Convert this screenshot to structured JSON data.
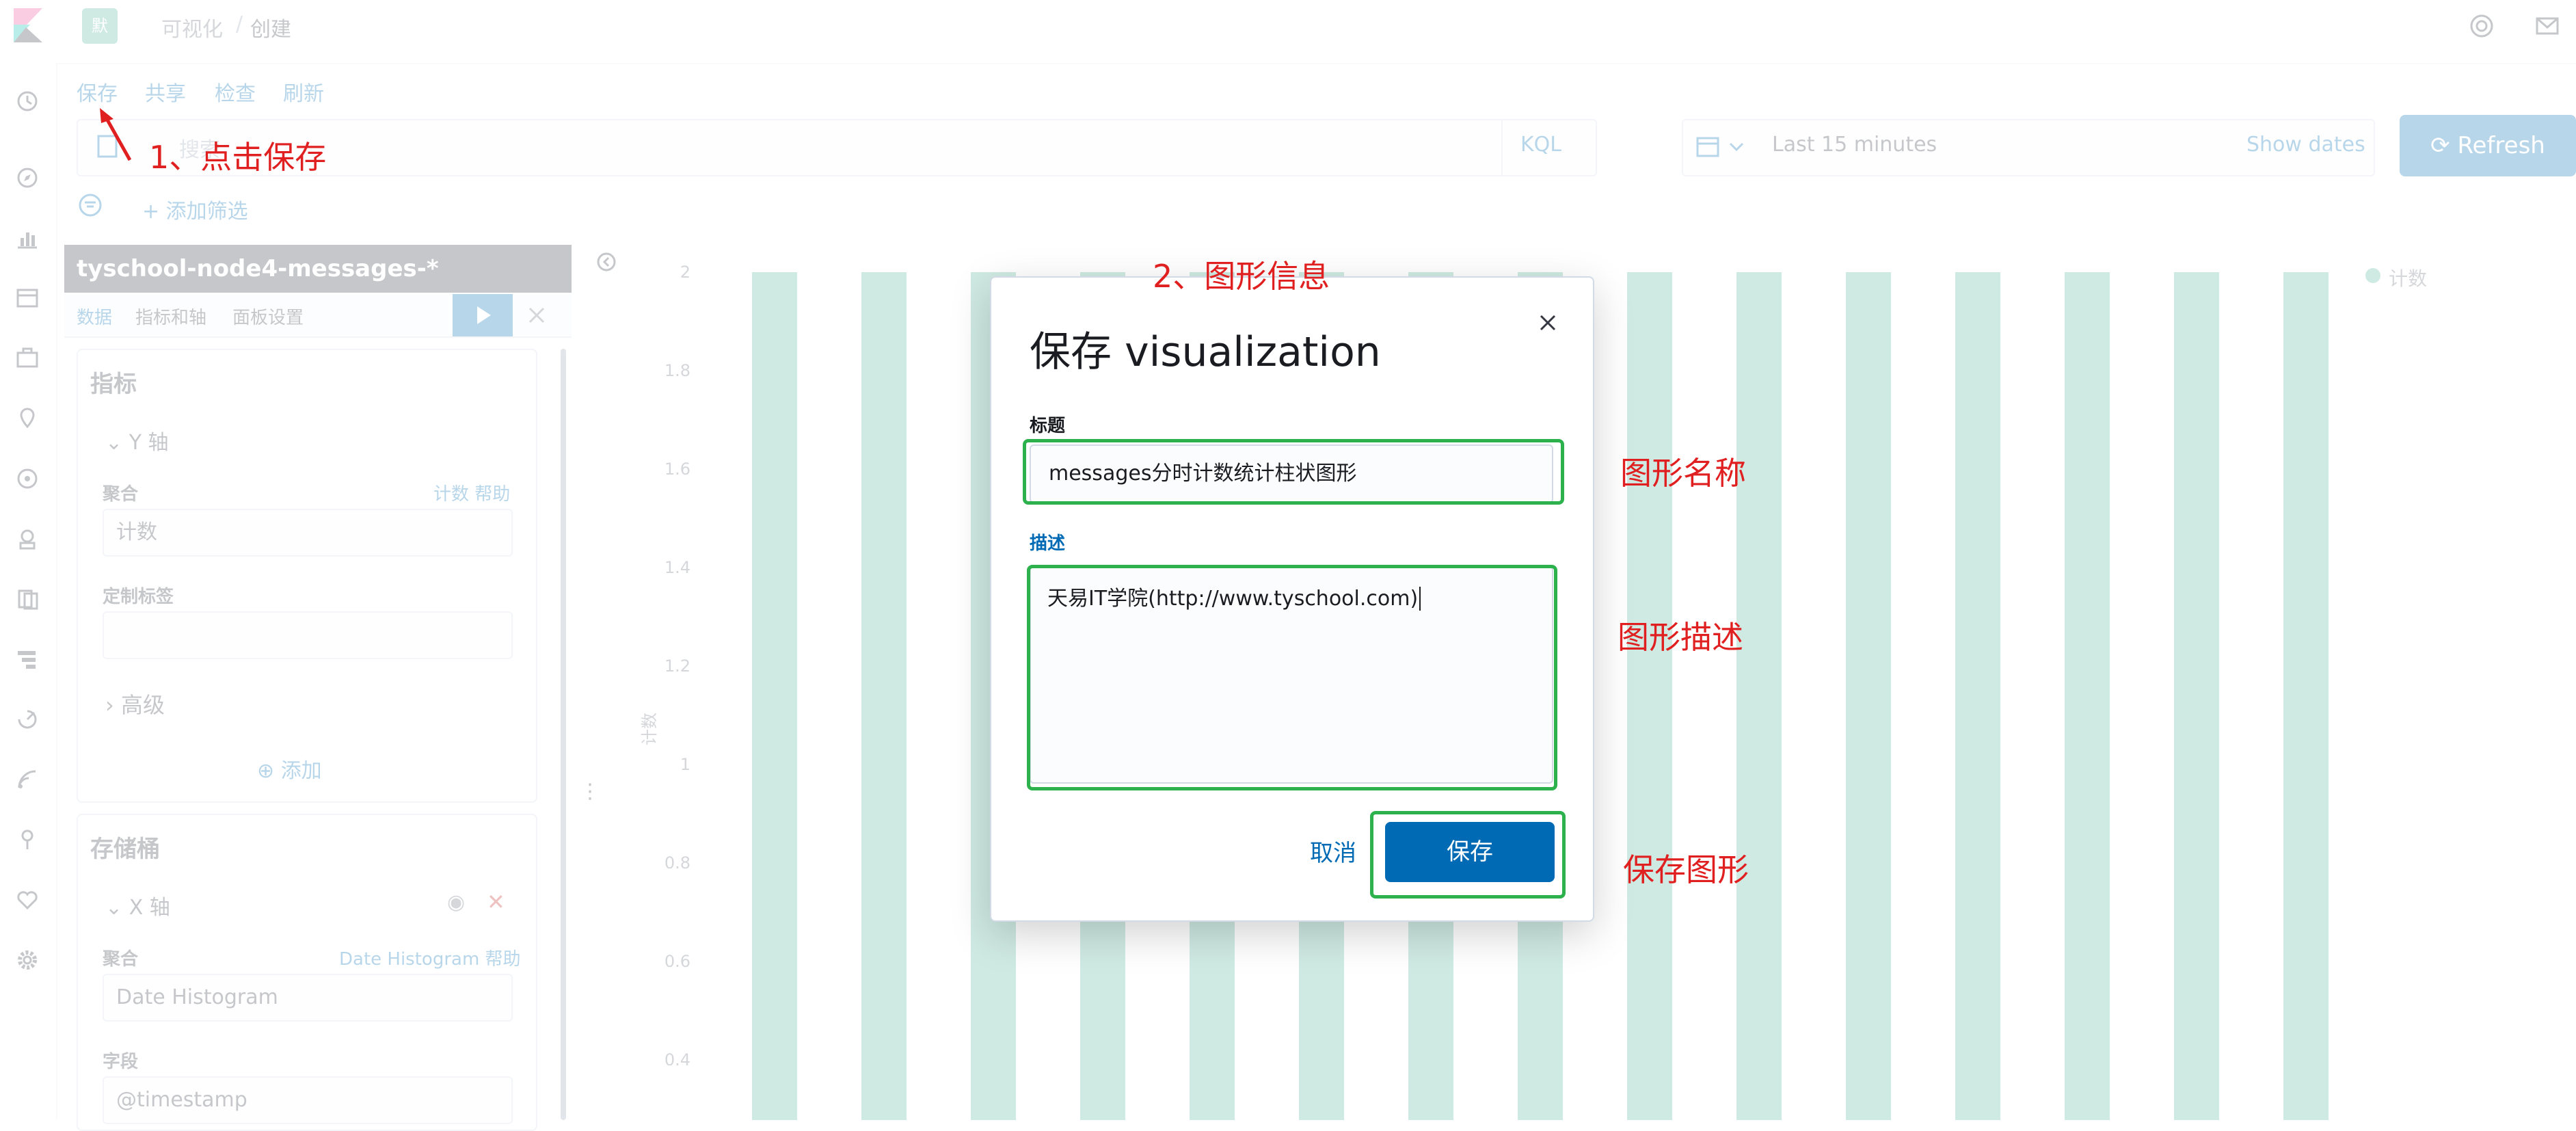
{
  "header": {
    "space_letter": "默",
    "breadcrumb": [
      "可视化",
      "创建"
    ]
  },
  "toolbar": {
    "links": [
      "保存",
      "共享",
      "检查",
      "刷新"
    ],
    "search_placeholder": "搜索",
    "kql": "KQL",
    "time_range": "Last 15 minutes",
    "show_dates": "Show dates",
    "refresh": "Refresh",
    "add_filter": "+ 添加筛选"
  },
  "editor": {
    "index_pattern": "tyschool-node4-messages-*",
    "tabs": [
      "数据",
      "指标和轴",
      "面板设置"
    ],
    "metrics_title": "指标",
    "y_axis": "Y 轴",
    "aggregation_label": "聚合",
    "metric_help": "计数 帮助",
    "metric_value": "计数",
    "custom_label": "定制标签",
    "advanced": "高级",
    "add_button": "添加",
    "buckets_title": "存储桶",
    "x_axis": "X 轴",
    "bucket_help": "Date Histogram 帮助",
    "bucket_value": "Date Histogram",
    "field_label": "字段",
    "field_value": "@timestamp"
  },
  "chart": {
    "legend": "计数",
    "ylabel": "计数",
    "yticks": [
      "2",
      "1.8",
      "1.6",
      "1.4",
      "1.2",
      "1",
      "0.8",
      "0.6",
      "0.4"
    ]
  },
  "modal": {
    "title": "保存 visualization",
    "title_label": "标题",
    "title_value": "messages分时计数统计柱状图形",
    "desc_label": "描述",
    "desc_value": "天易IT学院(http://www.tyschool.com)",
    "cancel": "取消",
    "save": "保存"
  },
  "annotations": {
    "step1": "1、点击保存",
    "step2": "2、图形信息",
    "name": "图形名称",
    "desc": "图形描述",
    "save": "保存图形"
  },
  "colors": {
    "primary": "#006bb4",
    "bar": "#54b399",
    "highlight": "#2db14d",
    "annotation": "#e02020"
  }
}
